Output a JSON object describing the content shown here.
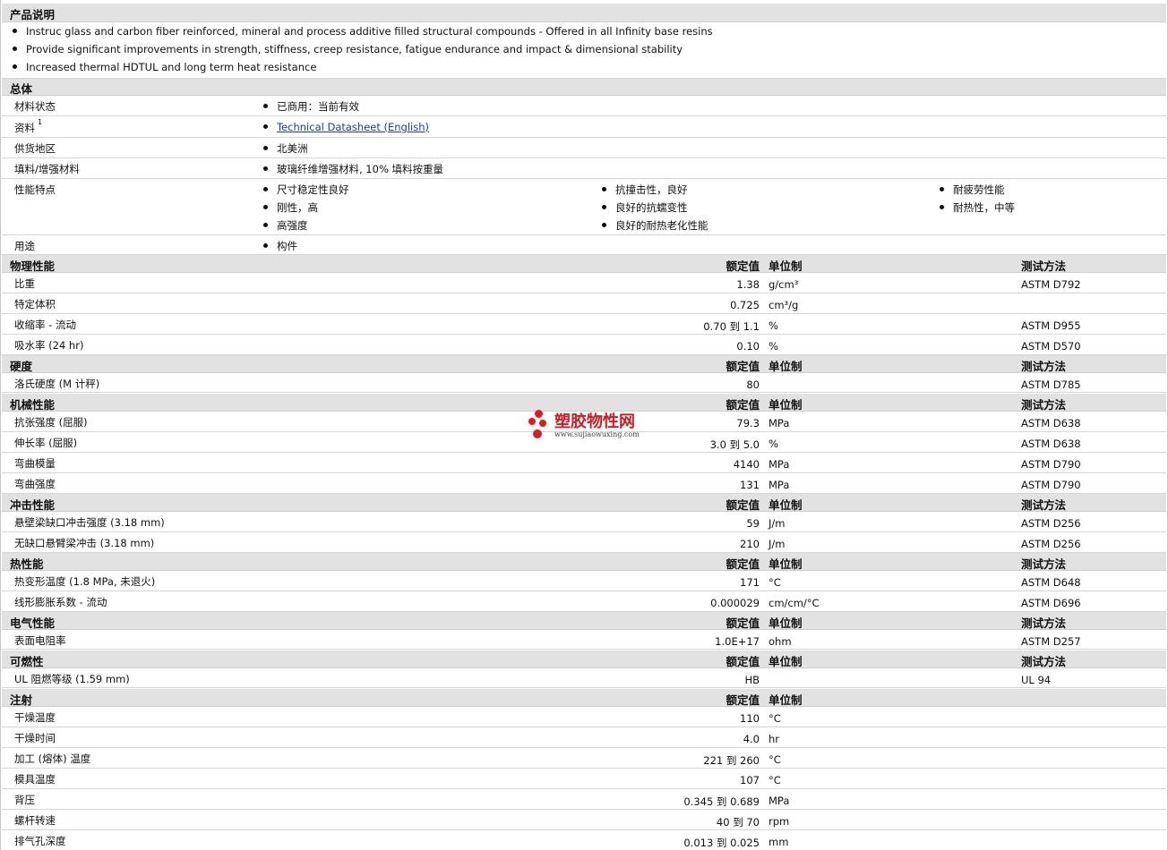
{
  "sections": {
    "desc": "产品说明",
    "general": "总体",
    "physical": "物理性能",
    "hardness": "硬度",
    "mechanical": "机械性能",
    "impact": "冲击性能",
    "thermal": "热性能",
    "electrical": "电气性能",
    "flammability": "可燃性",
    "injection": "注射"
  },
  "headers": {
    "nominal": "额定值",
    "unit": "单位制",
    "method": "测试方法"
  },
  "description": [
    "Instruc glass and carbon fiber reinforced, mineral and process additive filled structural compounds - Offered in all Infinity base resins",
    "Provide significant improvements in strength, stiffness, creep resistance, fatigue endurance and impact & dimensional stability",
    "Increased thermal HDTUL and long term heat resistance"
  ],
  "general": {
    "status_label": "材料状态",
    "status_value": "已商用：当前有效",
    "docs_label": "资料",
    "docs_sup": "1",
    "docs_link": "Technical Datasheet (English)",
    "region_label": "供货地区",
    "region_value": "北美洲",
    "filler_label": "填料/增强材料",
    "filler_value": "玻璃纤维增强材料, 10% 填料按重量",
    "features_label": "性能特点",
    "features": [
      "尺寸稳定性良好",
      "抗撞击性，良好",
      "耐疲劳性能",
      "刚性，高",
      "良好的抗蠕变性",
      "耐热性，中等",
      "高强度",
      "良好的耐热老化性能"
    ],
    "use_label": "用途",
    "use_value": "构件"
  },
  "physical": [
    {
      "label": "比重",
      "value": "1.38",
      "unit": "g/cm³",
      "method": "ASTM D792"
    },
    {
      "label": "特定体积",
      "value": "0.725",
      "unit": "cm³/g",
      "method": ""
    },
    {
      "label": "收缩率 - 流动",
      "value": "0.70 到 1.1",
      "unit": "%",
      "method": "ASTM D955"
    },
    {
      "label": "吸水率 (24 hr)",
      "value": "0.10",
      "unit": "%",
      "method": "ASTM D570"
    }
  ],
  "hardness": [
    {
      "label": "洛氏硬度 (M 计秤)",
      "value": "80",
      "unit": "",
      "method": "ASTM D785"
    }
  ],
  "mechanical": [
    {
      "label": "抗张强度 (屈服)",
      "value": "79.3",
      "unit": "MPa",
      "method": "ASTM D638"
    },
    {
      "label": "伸长率 (屈服)",
      "value": "3.0 到 5.0",
      "unit": "%",
      "method": "ASTM D638"
    },
    {
      "label": "弯曲模量",
      "value": "4140",
      "unit": "MPa",
      "method": "ASTM D790"
    },
    {
      "label": "弯曲强度",
      "value": "131",
      "unit": "MPa",
      "method": "ASTM D790"
    }
  ],
  "impact": [
    {
      "label": "悬壁梁缺口冲击强度 (3.18 mm)",
      "value": "59",
      "unit": "J/m",
      "method": "ASTM D256"
    },
    {
      "label": "无缺口悬臂梁冲击 (3.18 mm)",
      "value": "210",
      "unit": "J/m",
      "method": "ASTM D256"
    }
  ],
  "thermal": [
    {
      "label": "热变形温度 (1.8 MPa, 未退火)",
      "value": "171",
      "unit": "°C",
      "method": "ASTM D648"
    },
    {
      "label": "线形膨胀系数 - 流动",
      "value": "0.000029",
      "unit": "cm/cm/°C",
      "method": "ASTM D696"
    }
  ],
  "electrical": [
    {
      "label": "表面电阻率",
      "value": "1.0E+17",
      "unit": "ohm",
      "method": "ASTM D257"
    }
  ],
  "flammability": [
    {
      "label": "UL 阻燃等级 (1.59 mm)",
      "value": "HB",
      "unit": "",
      "method": "UL 94"
    }
  ],
  "injection": [
    {
      "label": "干燥温度",
      "value": "110",
      "unit": "°C",
      "method": ""
    },
    {
      "label": "干燥时间",
      "value": "4.0",
      "unit": "hr",
      "method": ""
    },
    {
      "label": "加工 (熔体) 温度",
      "value": "221 到 260",
      "unit": "°C",
      "method": ""
    },
    {
      "label": "模具温度",
      "value": "107",
      "unit": "°C",
      "method": ""
    },
    {
      "label": "背压",
      "value": "0.345 到 0.689",
      "unit": "MPa",
      "method": ""
    },
    {
      "label": "螺杆转速",
      "value": "40 到 70",
      "unit": "rpm",
      "method": ""
    },
    {
      "label": "排气孔深度",
      "value": "0.013 到 0.025",
      "unit": "mm",
      "method": ""
    }
  ],
  "watermark": {
    "name": "塑胶物性网",
    "url": "www.sujiaowuxing.com"
  }
}
